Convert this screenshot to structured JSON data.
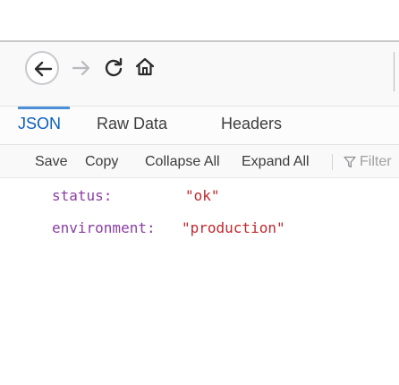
{
  "navigation": {
    "back_icon": "left-arrow-icon",
    "forward_icon": "right-arrow-icon",
    "reload_icon": "reload-icon",
    "home_icon": "home-icon"
  },
  "tabs": [
    {
      "label": "JSON",
      "active": true
    },
    {
      "label": "Raw Data",
      "active": false
    },
    {
      "label": "Headers",
      "active": false
    }
  ],
  "toolbar": {
    "save_label": "Save",
    "copy_label": "Copy",
    "collapse_all_label": "Collapse All",
    "expand_all_label": "Expand All",
    "filter_placeholder": "Filter",
    "filter_icon": "funnel-icon"
  },
  "json_rows": [
    {
      "key": "status:",
      "value": "\"ok\""
    },
    {
      "key": "environment:",
      "value": "\"production\""
    }
  ],
  "colors": {
    "accent": "#0b5fbf",
    "key": "#8a3fa1",
    "string_value": "#c0282d"
  }
}
